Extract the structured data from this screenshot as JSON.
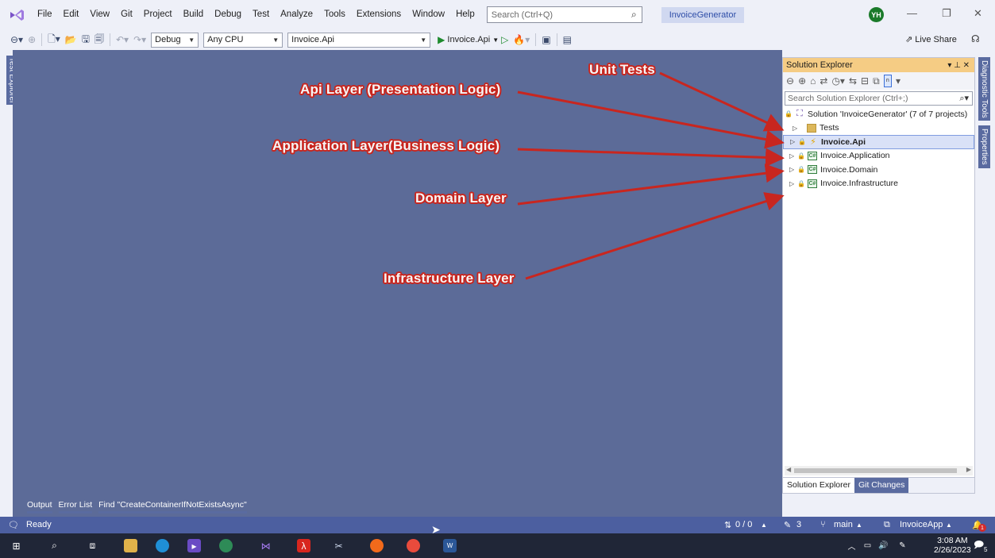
{
  "menubar": {
    "items": [
      "File",
      "Edit",
      "View",
      "Git",
      "Project",
      "Build",
      "Debug",
      "Test",
      "Analyze",
      "Tools",
      "Extensions",
      "Window",
      "Help"
    ],
    "search_placeholder": "Search (Ctrl+Q)",
    "solution_name": "InvoiceGenerator",
    "avatar_initials": "YH"
  },
  "toolbar": {
    "config": "Debug",
    "platform": "Any CPU",
    "startup_project": "Invoice.Api",
    "run_label": "Invoice.Api",
    "live_share": "Live Share"
  },
  "left_rail": {
    "test_explorer": "Test Explorer"
  },
  "right_rail": {
    "diagnostic_tools": "Diagnostic Tools",
    "properties": "Properties"
  },
  "solution_explorer": {
    "title": "Solution Explorer",
    "search_placeholder": "Search Solution Explorer (Ctrl+;)",
    "tree": [
      {
        "label": "Solution 'InvoiceGenerator' (7 of 7 projects)",
        "icon": "solution-icon"
      },
      {
        "label": "Tests",
        "icon": "folder-icon"
      },
      {
        "label": "Invoice.Api",
        "icon": "web-api-icon",
        "selected": true
      },
      {
        "label": "Invoice.Application",
        "icon": "csharp-project-icon"
      },
      {
        "label": "Invoice.Domain",
        "icon": "csharp-project-icon"
      },
      {
        "label": "Invoice.Infrastructure",
        "icon": "csharp-project-icon"
      }
    ],
    "tabs": [
      "Solution Explorer",
      "Git Changes"
    ]
  },
  "bottom_tabs": [
    "Output",
    "Error List",
    "Find \"CreateContainerIfNotExistsAsync\""
  ],
  "statusbar": {
    "ready": "Ready",
    "errors": "0 / 0",
    "edits": "3",
    "branch": "main",
    "repo": "InvoiceApp",
    "notifications": "1"
  },
  "taskbar": {
    "time": "3:08 AM",
    "date": "2/26/2023",
    "notification_count": "5"
  },
  "annotations": {
    "unit_tests": "Unit Tests",
    "api_layer": "Api Layer (Presentation Logic)",
    "application_layer": "Application Layer(Business Logic)",
    "domain_layer": "Domain Layer",
    "infrastructure_layer": "Infrastructure Layer"
  },
  "colors": {
    "editor_bg": "#5c6b98",
    "statusbar": "#4c5fa0",
    "annotation_red": "#c8261f",
    "panel_header": "#f5cc84"
  }
}
